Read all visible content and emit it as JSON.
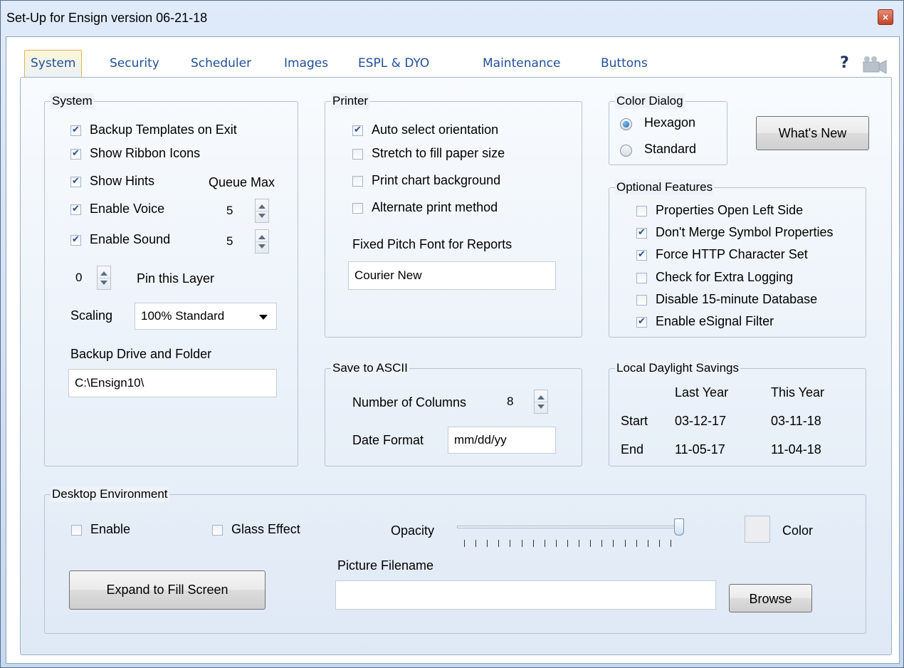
{
  "window": {
    "title": "Set-Up for Ensign version 06-21-18",
    "close_glyph": "×"
  },
  "tabs": [
    {
      "label": "System",
      "active": true
    },
    {
      "label": "Security"
    },
    {
      "label": "Scheduler"
    },
    {
      "label": "Images"
    },
    {
      "label": "ESPL & DYO"
    },
    {
      "label": "Maintenance"
    },
    {
      "label": "Buttons"
    }
  ],
  "help": {
    "glyph": "?",
    "camera_icon": "camera-icon"
  },
  "system": {
    "title": "System",
    "backup_templates": {
      "label": "Backup Templates on Exit",
      "checked": true
    },
    "show_ribbon": {
      "label": "Show Ribbon Icons",
      "checked": true
    },
    "show_hints": {
      "label": "Show Hints",
      "checked": true
    },
    "queue_max_label": "Queue Max",
    "enable_voice": {
      "label": "Enable Voice",
      "checked": true,
      "value": "5"
    },
    "enable_sound": {
      "label": "Enable Sound",
      "checked": true,
      "value": "5"
    },
    "pin_layer": {
      "value": "0",
      "label": "Pin this Layer"
    },
    "scaling": {
      "label": "Scaling",
      "value": "100% Standard"
    },
    "backup_drive": {
      "label": "Backup Drive and Folder",
      "value": "C:\\Ensign10\\"
    }
  },
  "printer": {
    "title": "Printer",
    "auto_orient": {
      "label": "Auto select orientation",
      "checked": true
    },
    "stretch": {
      "label": "Stretch to fill paper size",
      "checked": false
    },
    "print_bg": {
      "label": "Print chart background",
      "checked": false
    },
    "alt_print": {
      "label": "Alternate print method",
      "checked": false
    },
    "font_label": "Fixed Pitch Font for Reports",
    "font_value": "Courier New"
  },
  "color_dialog": {
    "title": "Color Dialog",
    "hexagon": {
      "label": "Hexagon",
      "selected": true
    },
    "standard": {
      "label": "Standard",
      "selected": false
    },
    "whats_new": "What's New"
  },
  "optional": {
    "title": "Optional Features",
    "items": [
      {
        "label": "Properties Open Left Side",
        "checked": false
      },
      {
        "label": "Don't Merge Symbol Properties",
        "checked": true
      },
      {
        "label": "Force HTTP Character Set",
        "checked": true
      },
      {
        "label": "Check for Extra Logging",
        "checked": false
      },
      {
        "label": "Disable 15-minute Database",
        "checked": false
      },
      {
        "label": "Enable eSignal Filter",
        "checked": true
      }
    ]
  },
  "ascii": {
    "title": "Save to ASCII",
    "columns_label": "Number of Columns",
    "columns_value": "8",
    "date_label": "Date Format",
    "date_value": "mm/dd/yy"
  },
  "daylight": {
    "title": "Local Daylight Savings",
    "last_year": "Last Year",
    "this_year": "This Year",
    "start": {
      "label": "Start",
      "last": "03-12-17",
      "this": "03-11-18"
    },
    "end": {
      "label": "End",
      "last": "11-05-17",
      "this": "11-04-18"
    }
  },
  "desktop": {
    "title": "Desktop Environment",
    "enable": {
      "label": "Enable",
      "checked": false
    },
    "glass": {
      "label": "Glass Effect",
      "checked": false
    },
    "opacity_label": "Opacity",
    "opacity_level": 1.0,
    "color_label": "Color",
    "expand_button": "Expand to Fill Screen",
    "picture_label": "Picture Filename",
    "picture_value": "",
    "browse_button": "Browse"
  }
}
